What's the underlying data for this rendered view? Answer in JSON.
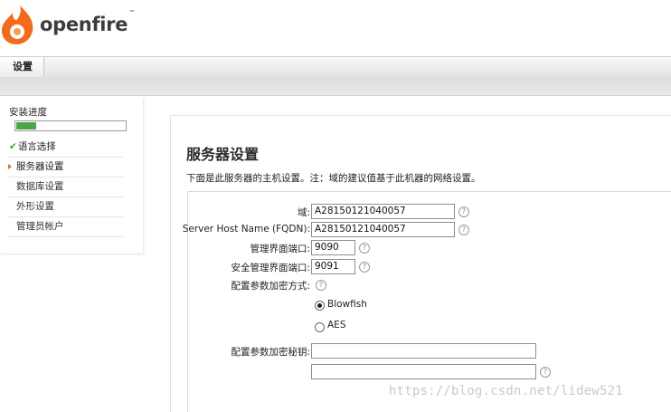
{
  "brand": {
    "name": "openfire",
    "trademark": "™",
    "accent": "#f26b1d"
  },
  "tabs": [
    {
      "label": "设置"
    }
  ],
  "sidebar": {
    "heading": "安装进度",
    "progress": 0.18,
    "items": [
      {
        "label": "语言选择",
        "state": "done"
      },
      {
        "label": "服务器设置",
        "state": "current"
      },
      {
        "label": "数据库设置",
        "state": "pending"
      },
      {
        "label": "外形设置",
        "state": "pending"
      },
      {
        "label": "管理员帐户",
        "state": "pending"
      }
    ]
  },
  "main": {
    "title": "服务器设置",
    "description": "下面是此服务器的主机设置。注：域的建议值基于此机器的网络设置。",
    "form": {
      "domain_label": "域:",
      "domain_value": "A28150121040057",
      "fqdn_label": "Server Host Name (FQDN):",
      "fqdn_value": "A28150121040057",
      "admin_port_label": "管理界面端口:",
      "admin_port_value": "9090",
      "secure_port_label": "安全管理界面端口:",
      "secure_port_value": "9091",
      "encryption_label": "配置参数加密方式:",
      "encryption_options": [
        {
          "label": "Blowfish",
          "selected": true
        },
        {
          "label": "AES",
          "selected": false
        }
      ],
      "key_label": "配置参数加密秘钥:",
      "key_value": "",
      "key_confirm_value": ""
    }
  },
  "icons": {
    "help": "help-circle-icon",
    "check": "check-icon",
    "arrow": "arrow-right-icon"
  },
  "watermark": "https://blog.csdn.net/lidew521"
}
